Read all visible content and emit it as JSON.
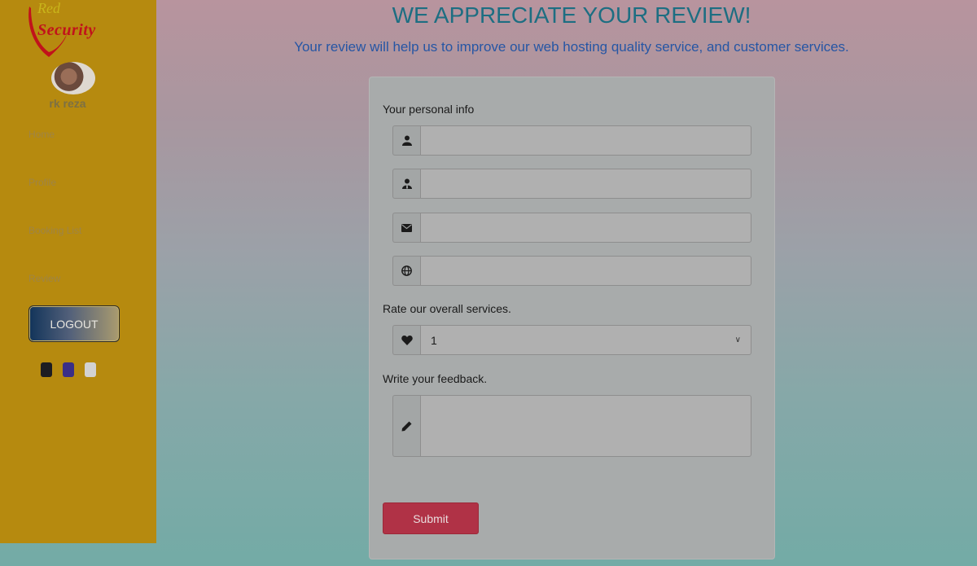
{
  "brand": {
    "name_top": "Red",
    "name_bottom": "Security"
  },
  "user": {
    "name": "rk reza"
  },
  "sidebar": {
    "items": [
      {
        "label": "Home"
      },
      {
        "label": "Profile"
      },
      {
        "label": "Booking List"
      },
      {
        "label": "Review"
      }
    ],
    "logout_label": "LOGOUT",
    "theme_swatches": [
      "#1d1d22",
      "#3a2f87",
      "#d2d2d2"
    ]
  },
  "header": {
    "title": "WE APPRECIATE YOUR REVIEW!",
    "subtitle": "Your review will help us to improve our web hosting quality service, and customer services."
  },
  "form": {
    "personal_info_label": "Your personal info",
    "fields": [
      {
        "icon": "user-icon",
        "value": ""
      },
      {
        "icon": "user-tie-icon",
        "value": ""
      },
      {
        "icon": "envelope-icon",
        "value": ""
      },
      {
        "icon": "globe-icon",
        "value": ""
      }
    ],
    "rating_label": "Rate our overall services.",
    "rating": {
      "icon": "heart-icon",
      "selected": "1"
    },
    "feedback_label": "Write your feedback.",
    "feedback": {
      "icon": "pencil-icon",
      "value": ""
    },
    "submit_label": "Submit"
  },
  "colors": {
    "sidebar_bg": "#b68a0f",
    "title": "#1d6e82",
    "subtitle": "#2656a4",
    "submit_bg": "#b03246"
  }
}
